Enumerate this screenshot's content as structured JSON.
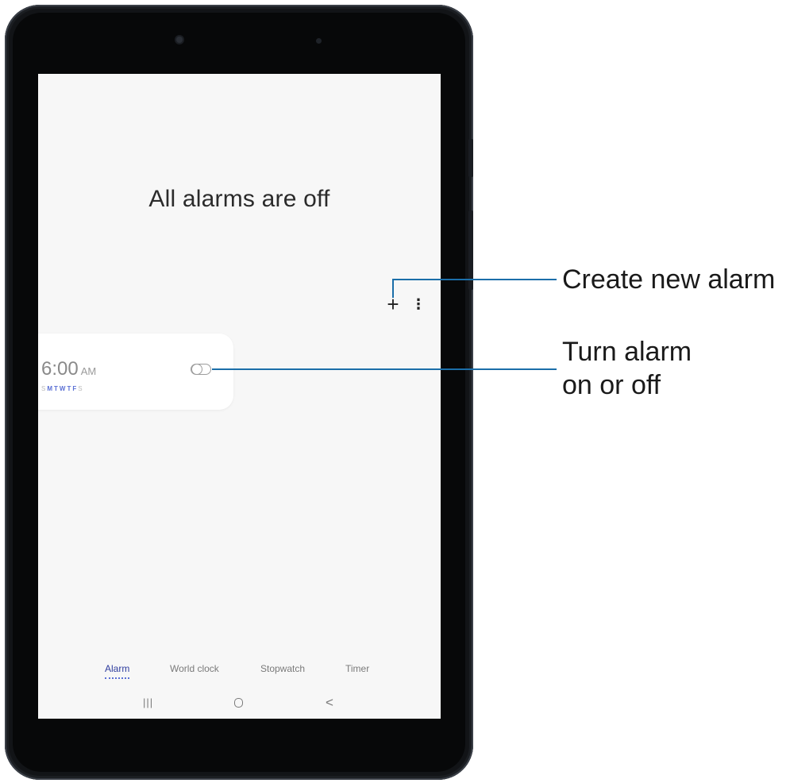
{
  "screen": {
    "empty_state_title": "All alarms are off",
    "actions": {
      "add_icon": "plus-icon",
      "add_glyph": "+",
      "more_icon": "more-vertical-icon",
      "more_glyph": "⋮"
    },
    "alarm": {
      "time": "6:00",
      "ampm": "AM",
      "days": [
        {
          "letter": "S",
          "active": false
        },
        {
          "letter": "M",
          "active": true
        },
        {
          "letter": "T",
          "active": true
        },
        {
          "letter": "W",
          "active": true
        },
        {
          "letter": "T",
          "active": true
        },
        {
          "letter": "F",
          "active": true
        },
        {
          "letter": "S",
          "active": false
        }
      ],
      "enabled": false
    },
    "tabs": [
      {
        "label": "Alarm",
        "active": true
      },
      {
        "label": "World clock",
        "active": false
      },
      {
        "label": "Stopwatch",
        "active": false
      },
      {
        "label": "Timer",
        "active": false
      }
    ],
    "nav": {
      "recent_glyph": "|||",
      "back_glyph": "<"
    }
  },
  "callouts": {
    "create_new_alarm": "Create new alarm",
    "turn_alarm_line1": "Turn alarm",
    "turn_alarm_line2": "on or off",
    "line_color": "#1b6ea9"
  },
  "colors": {
    "accent": "#5a6fd4",
    "active_tab": "#2f3d9e",
    "screen_bg": "#f7f7f7",
    "device_body": "#121417"
  }
}
